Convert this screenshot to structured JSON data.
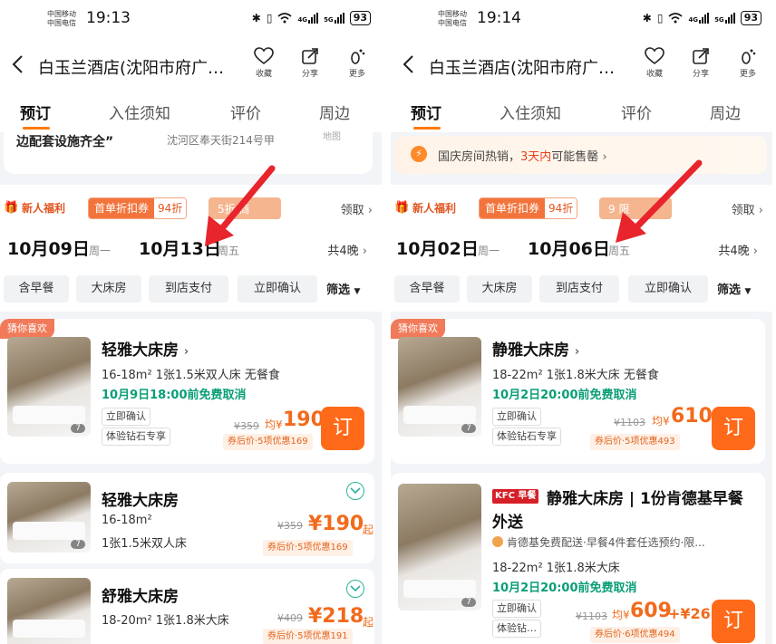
{
  "left": {
    "status": {
      "carrier1": "中国移动",
      "carrier2": "中国电信",
      "time": "19:13",
      "battery": "93"
    },
    "header": {
      "title": "白玉兰酒店(沈阳市府广…",
      "fav": "收藏",
      "share": "分享",
      "more": "更多"
    },
    "tabs": [
      "预订",
      "入住须知",
      "评价",
      "周边"
    ],
    "info": {
      "left": "边配套设施齐全”",
      "right": "沈河区奉天街214号甲",
      "map": "地图"
    },
    "booking": {
      "newuser": "新人福利",
      "coupon": "首单折扣券",
      "coupon_discount": "94折",
      "coupon2": "5折 商",
      "receive": "领取",
      "checkin": "10月09日",
      "checkin_dow": "周一",
      "checkout": "10月13日",
      "checkout_dow": "周五",
      "nights": "共4晚"
    },
    "chips": [
      "含早餐",
      "大床房",
      "到店支付",
      "立即确认"
    ],
    "filter": "筛选",
    "rooms": [
      {
        "badge": "猜你喜欢",
        "name": "轻雅大床房",
        "spec": "16-18m²   1张1.5米双人床   无餐食",
        "cancel": "10月9日18:00前免费取消",
        "tag1": "立即确认",
        "tag2": "体验钻石专享",
        "old": "¥359",
        "avg": "均¥",
        "price": "190",
        "after": "券后价·5项优惠169",
        "book": "订",
        "pics": "7"
      },
      {
        "name": "轻雅大床房",
        "spec1": "16-18m²",
        "spec2": "1张1.5米双人床",
        "old": "¥359",
        "price": "¥190",
        "suffix": "起",
        "after": "券后价·5项优惠169",
        "pics": "7"
      },
      {
        "name": "舒雅大床房",
        "spec": "18-20m²   1张1.8米大床",
        "old": "¥409",
        "price": "¥218",
        "suffix": "起",
        "after": "券后价·5项优惠191"
      }
    ]
  },
  "right": {
    "status": {
      "carrier1": "中国移动",
      "carrier2": "中国电信",
      "time": "19:14",
      "battery": "93"
    },
    "header": {
      "title": "白玉兰酒店(沈阳市府广…",
      "fav": "收藏",
      "share": "分享",
      "more": "更多"
    },
    "tabs": [
      "预订",
      "入住须知",
      "评价",
      "周边"
    ],
    "promo": {
      "text1": "国庆房间热销，",
      "hl": "3天内",
      "text2": "可能售罄"
    },
    "booking": {
      "newuser": "新人福利",
      "coupon": "首单折扣券",
      "coupon_discount": "94折",
      "coupon2": "9 限",
      "receive": "领取",
      "checkin": "10月02日",
      "checkin_dow": "周一",
      "checkout": "10月06日",
      "checkout_dow": "周五",
      "nights": "共4晚"
    },
    "chips": [
      "含早餐",
      "大床房",
      "到店支付",
      "立即确认"
    ],
    "filter": "筛选",
    "rooms": [
      {
        "badge": "猜你喜欢",
        "name": "静雅大床房",
        "spec": "18-22m²   1张1.8米大床   无餐食",
        "cancel": "10月2日20:00前免费取消",
        "tag1": "立即确认",
        "tag2": "体验钻石专享",
        "old": "¥1103",
        "avg": "均¥",
        "price": "610",
        "after": "券后价·5项优惠493",
        "book": "订",
        "pics": "7"
      },
      {
        "kfc": "KFC 早餐",
        "name": "静雅大床房 | 1份肯德基早餐",
        "name2": "外送",
        "kfc_line": "肯德基免费配送·早餐4件套任选预约·限...",
        "spec": "18-22m²   1张1.8米大床",
        "cancel": "10月2日20:00前免费取消",
        "tag1": "立即确认",
        "tag2": "体验钻…",
        "old": "¥1103",
        "avg": "均¥",
        "price": "609",
        "plus": "+¥26",
        "after": "券后价·6项优惠494",
        "book": "订",
        "pics": "7"
      }
    ]
  },
  "colors": {
    "accent": "#ff6a1a",
    "green": "#0a9e76",
    "arrow": "#e8242c"
  }
}
